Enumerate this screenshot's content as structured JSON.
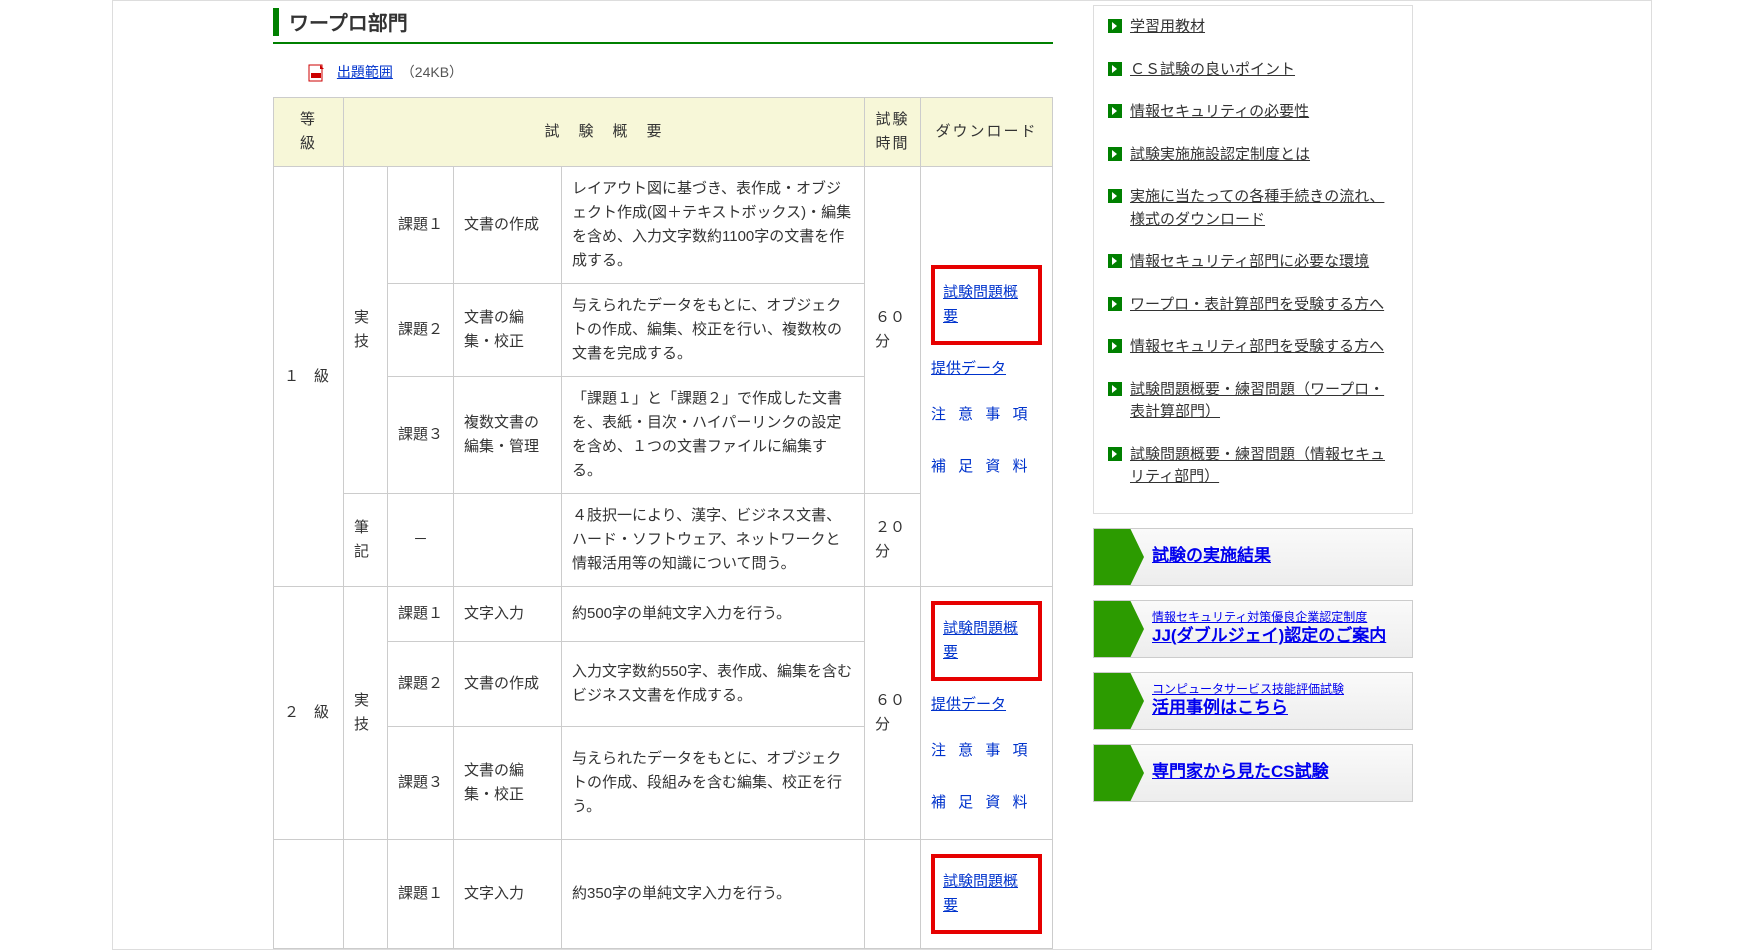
{
  "section_title": "ワープロ部門",
  "pdf": {
    "label": "出題範囲",
    "size": "（24KB）"
  },
  "table_headers": {
    "grade": "等　級",
    "overview": "試　験　概　要",
    "time": "試験時間",
    "download": "ダウンロード"
  },
  "grades": [
    {
      "name": "１　級",
      "practical_label": "実技",
      "written_label": "筆記",
      "practical_rows": [
        {
          "task": "課題１",
          "unit": "文書の作成",
          "desc": "レイアウト図に基づき、表作成・オブジェクト作成(図＋テキストボックス)・編集を含め、入力文字数約1100字の文書を作成する。"
        },
        {
          "task": "課題２",
          "unit": "文書の編集・校正",
          "desc": "与えられたデータをもとに、オブジェクトの作成、編集、校正を行い、複数枚の文書を完成する。"
        },
        {
          "task": "課題３",
          "unit": "複数文書の編集・管理",
          "desc": "「課題１」と「課題２」で作成した文書を、表紙・目次・ハイパーリンクの設定を含め、１つの文書ファイルに編集する。"
        }
      ],
      "written_row": {
        "task": "－",
        "unit": "",
        "desc": "４肢択一により、漢字、ビジネス文書、ハード・ソフトウェア、ネットワークと情報活用等の知識について問う。"
      },
      "practical_time": "６０分",
      "written_time": "２０分",
      "downloads": {
        "overview": "試験問題概要",
        "data": "提供データ",
        "notice": "注 意 事 項",
        "supplement": "補 足 資 料"
      }
    },
    {
      "name": "２　級",
      "practical_label": "実技",
      "practical_rows": [
        {
          "task": "課題１",
          "unit": "文字入力",
          "desc": "約500字の単純文字入力を行う。"
        },
        {
          "task": "課題２",
          "unit": "文書の作成",
          "desc": "入力文字数約550字、表作成、編集を含むビジネス文書を作成する。"
        },
        {
          "task": "課題３",
          "unit": "文書の編集・校正",
          "desc": "与えられたデータをもとに、オブジェクトの作成、段組みを含む編集、校正を行う。"
        }
      ],
      "practical_time": "６０分",
      "downloads": {
        "overview": "試験問題概要",
        "data": "提供データ",
        "notice": "注 意 事 項",
        "supplement": "補 足 資 料"
      }
    },
    {
      "name": "",
      "row3": {
        "task": "課題１",
        "unit": "文字入力",
        "desc": "約350字の単純文字入力を行う。"
      },
      "downloads": {
        "overview": "試験問題概要"
      }
    }
  ],
  "sidebar": {
    "links": [
      "学習用教材",
      "ＣＳ試験の良いポイント",
      "情報セキュリティの必要性",
      "試験実施施設認定制度とは",
      "実施に当たっての各種手続きの流れ、様式のダウンロード",
      "情報セキュリティ部門に必要な環境",
      "ワープロ・表計算部門を受験する方へ",
      "情報セキュリティ部門を受験する方へ",
      "試験問題概要・練習問題（ワープロ・表計算部門）",
      "試験問題概要・練習問題（情報セキュリティ部門）"
    ],
    "banners": [
      {
        "main": "試験の実施結果",
        "small": ""
      },
      {
        "main": "JJ(ダブルジェイ)認定のご案内",
        "small": "情報セキュリティ対策優良企業認定制度"
      },
      {
        "main": "活用事例はこちら",
        "small": "コンピュータサービス技能評価試験"
      },
      {
        "main": "専門家から見たCS試験",
        "small": ""
      }
    ]
  }
}
